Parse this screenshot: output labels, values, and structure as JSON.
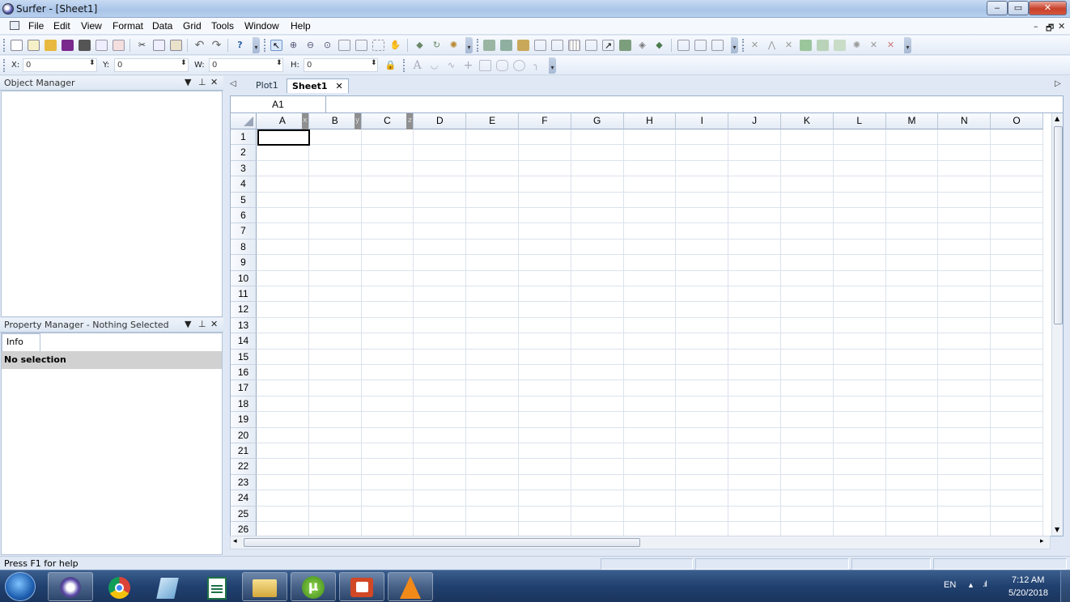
{
  "window": {
    "title": "Surfer - [Sheet1]"
  },
  "window_controls": {
    "minimize": "‒",
    "maximize": "▭",
    "close": "✕"
  },
  "mdi_controls": {
    "minimize": "–",
    "restore": "🗗",
    "close": "✕"
  },
  "menu": [
    "File",
    "Edit",
    "View",
    "Format",
    "Data",
    "Grid",
    "Tools",
    "Window",
    "Help"
  ],
  "coords": {
    "x": {
      "label": "X:",
      "value": "0"
    },
    "y": {
      "label": "Y:",
      "value": "0"
    },
    "w": {
      "label": "W:",
      "value": "0"
    },
    "h": {
      "label": "H:",
      "value": "0"
    }
  },
  "object_manager": {
    "title": "Object Manager"
  },
  "property_manager": {
    "title": "Property Manager - Nothing Selected",
    "tab": "Info",
    "selection_text": "No selection"
  },
  "doc_tabs": [
    "Plot1",
    "Sheet1"
  ],
  "formula_bar": {
    "cell_ref": "A1",
    "content": ""
  },
  "sheet": {
    "columns": [
      "A",
      "B",
      "C",
      "D",
      "E",
      "F",
      "G",
      "H",
      "I",
      "J",
      "K",
      "L",
      "M",
      "N",
      "O"
    ],
    "axis_markers": [
      "x",
      "y",
      "z"
    ],
    "rows": [
      "1",
      "2",
      "3",
      "4",
      "5",
      "6",
      "7",
      "8",
      "9",
      "10",
      "11",
      "12",
      "13",
      "14",
      "15",
      "16",
      "17",
      "18",
      "19",
      "20",
      "21",
      "22",
      "23",
      "24",
      "25",
      "26"
    ],
    "selected_cell": "A1"
  },
  "status": {
    "help_text": "Press F1 for help"
  },
  "taskbar": {
    "apps": [
      "start-orb",
      "surfer",
      "chrome",
      "notepad",
      "excel",
      "explorer",
      "utorrent",
      "powerpoint",
      "vlc"
    ],
    "language": "EN",
    "time": "7:12 AM",
    "date": "5/20/2018"
  }
}
